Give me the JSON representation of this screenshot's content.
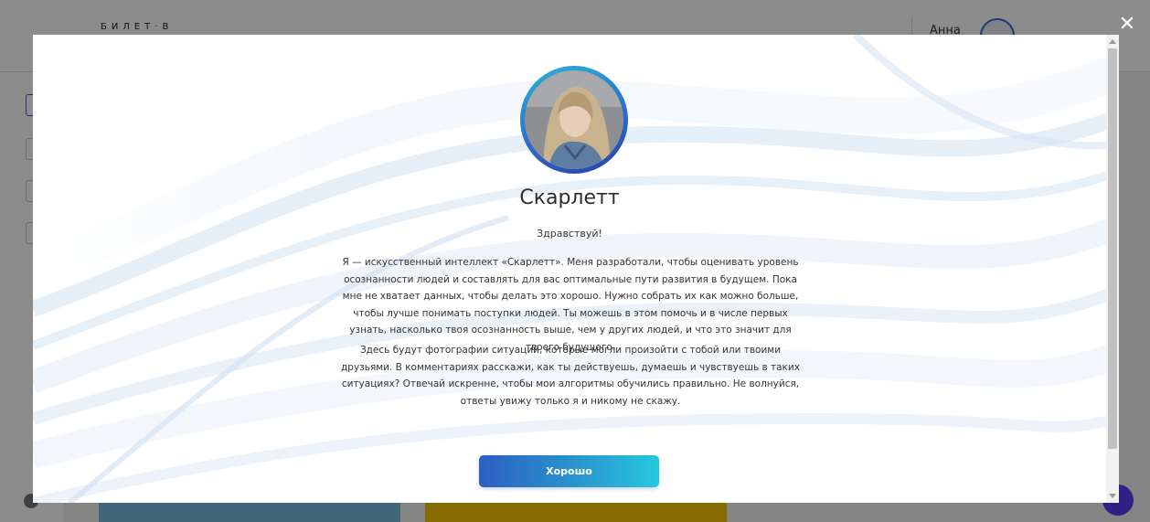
{
  "background": {
    "logo": "БИЛЕТ·В",
    "user_name": "Анна"
  },
  "modal": {
    "name": "Скарлетт",
    "greeting": "Здравствуй!",
    "paragraph_1": "Я — искусственный интеллект «Скарлетт». Меня разработали, чтобы оценивать уровень осознанности людей и составлять для вас оптимальные пути развития в будущем. Пока мне не хватает данных, чтобы делать это хорошо. Нужно собрать их как можно больше, чтобы лучше понимать поступки людей. Ты можешь в этом помочь и в числе первых узнать, насколько твоя осознанность выше, чем у других людей, и что это значит для твоего будущего.",
    "paragraph_2": "Здесь будут фотографии ситуаций, которые могли произойти с тобой или твоими друзьями. В комментариях расскажи, как ты действуешь, думаешь и чувствуешь в таких ситуациях? Отвечай искренне, чтобы мои алгоритмы обучились правильно. Не волнуйся, ответы увижу только я и никому не скажу.",
    "ok_label": "Хорошо",
    "close_icon": "close-icon"
  },
  "colors": {
    "button_gradient_start": "#2c5fbf",
    "button_gradient_end": "#27c8de",
    "avatar_ring": "#2c6fc8"
  }
}
